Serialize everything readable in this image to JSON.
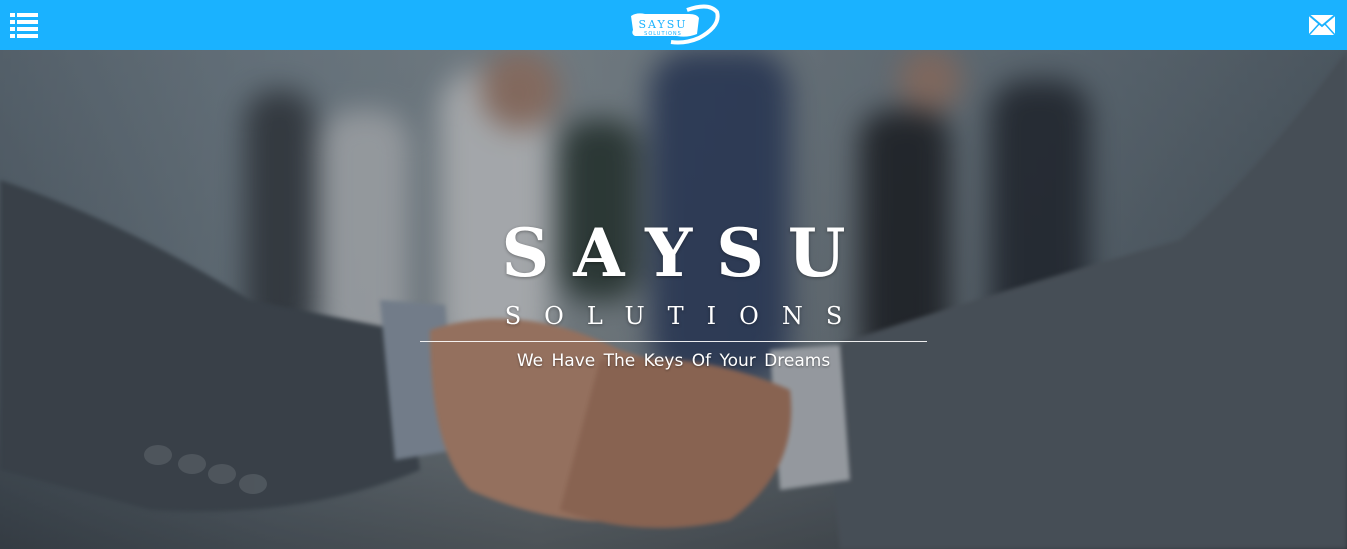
{
  "header": {
    "menu_icon": "list-menu-icon",
    "logo_text_main": "SAYSU",
    "logo_text_sub": "SOLUTIONS",
    "mail_icon": "envelope-icon",
    "background_color": "#1ab2ff"
  },
  "hero": {
    "title": "SAYSU",
    "subtitle": "SOLUTIONS",
    "tagline": "We Have The Keys Of Your Dreams",
    "background_image": "business-handshake-photo"
  }
}
